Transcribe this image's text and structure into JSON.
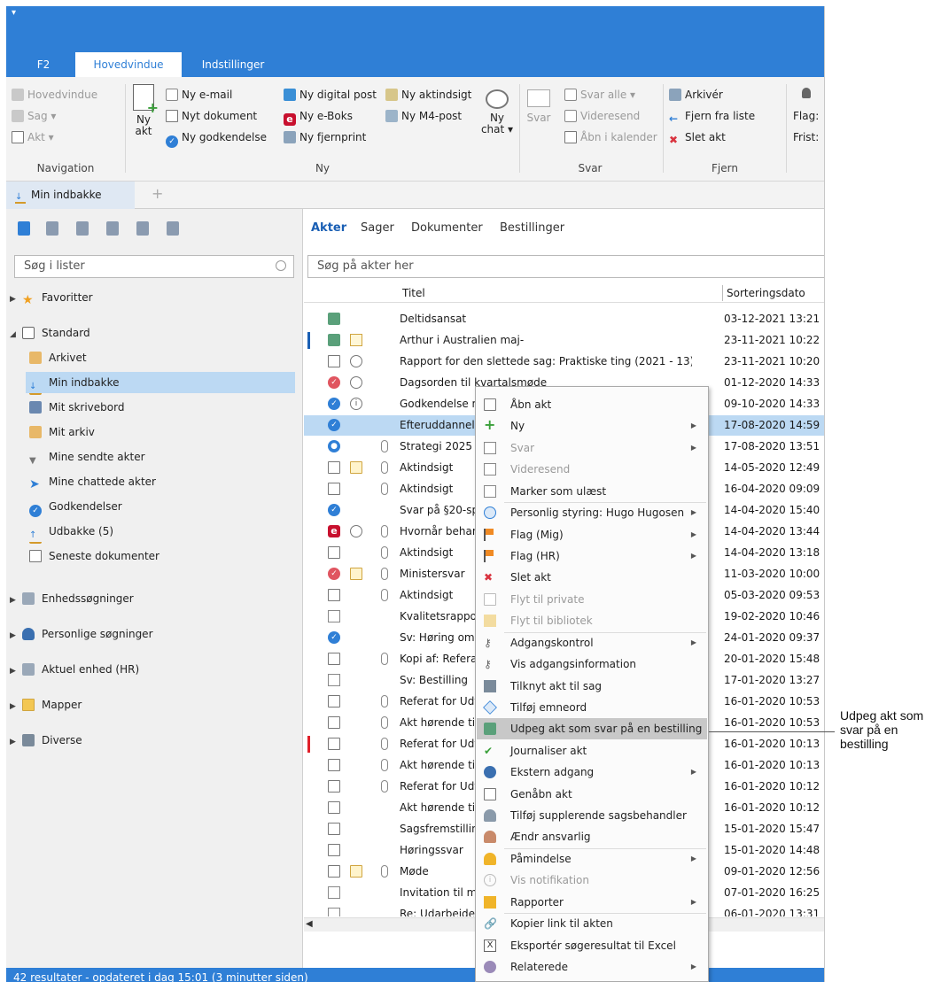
{
  "ribbon": {
    "tabs": [
      {
        "label": "F2",
        "active": false
      },
      {
        "label": "Hovedvindue",
        "active": true
      },
      {
        "label": "Indstillinger",
        "active": false
      }
    ],
    "navigation": {
      "label": "Navigation",
      "items": [
        "Hovedvindue",
        "Sag ▾",
        "Akt ▾"
      ]
    },
    "ny": {
      "label": "Ny",
      "big_button": "Ny akt",
      "col1": [
        "Ny e-mail",
        "Nyt dokument",
        "Ny godkendelse"
      ],
      "col2": [
        "Ny digital post",
        "Ny e-Boks",
        "Ny fjernprint"
      ],
      "col3": [
        "Ny aktindsigt",
        "Ny M4-post"
      ],
      "chat_button": "Ny chat ▾"
    },
    "svar": {
      "label": "Svar",
      "big_button": "Svar",
      "items": [
        "Svar alle ▾",
        "Videresend",
        "Åbn i kalender"
      ]
    },
    "fjern": {
      "label": "Fjern",
      "items": [
        "Arkivér",
        "Fjern fra liste",
        "Slet akt"
      ]
    },
    "flag_label": "Flag:",
    "frist_label": "Frist:"
  },
  "doc_tab": {
    "label": "Min indbakke"
  },
  "left": {
    "search_placeholder": "Søg i lister",
    "favoritter": "Favoritter",
    "standard": "Standard",
    "standard_items": [
      "Arkivet",
      "Min indbakke",
      "Mit skrivebord",
      "Mit arkiv",
      "Mine sendte akter",
      "Mine chattede akter",
      "Godkendelser",
      "Udbakke (5)",
      "Seneste dokumenter"
    ],
    "groups": [
      "Enhedssøgninger",
      "Personlige søgninger",
      "Aktuel enhed (HR)",
      "Mapper",
      "Diverse"
    ]
  },
  "right": {
    "tabs": [
      "Akter",
      "Sager",
      "Dokumenter",
      "Bestillinger"
    ],
    "search_placeholder": "Søg på akter her",
    "col_title": "Titel",
    "col_date": "Sorteringsdato",
    "rows": [
      {
        "title": "Deltidsansat",
        "date": "03-12-2021 13:21"
      },
      {
        "title": "Arthur i Australien maj-juli",
        "date": "23-11-2021 10:22"
      },
      {
        "title": "Rapport for den slettede sag: Praktiske ting (2021 - 13)",
        "date": "23-11-2021 10:20"
      },
      {
        "title": "Dagsorden til kvartalsmøde",
        "date": "01-12-2020 14:33"
      },
      {
        "title": "Godkendelse m",
        "date": "09-10-2020 14:33"
      },
      {
        "title": "Efteruddannelse",
        "date": "17-08-2020 14:59"
      },
      {
        "title": "Strategi 2025",
        "date": "17-08-2020 13:51"
      },
      {
        "title": "Aktindsigt",
        "date": "14-05-2020 12:49"
      },
      {
        "title": "Aktindsigt",
        "date": "16-04-2020 09:09"
      },
      {
        "title": "Svar på §20-sprø",
        "date": "14-04-2020 15:40"
      },
      {
        "title": "Hvornår behand",
        "date": "14-04-2020 13:44"
      },
      {
        "title": "Aktindsigt",
        "date": "14-04-2020 13:18"
      },
      {
        "title": "Ministersvar",
        "date": "11-03-2020 10:00"
      },
      {
        "title": "Aktindsigt",
        "date": "05-03-2020 09:53"
      },
      {
        "title": "Kvalitetsrapport",
        "date": "19-02-2020 10:46"
      },
      {
        "title": "Sv: Høring om h",
        "date": "24-01-2020 09:37"
      },
      {
        "title": "Kopi af: Referat f",
        "date": "20-01-2020 15:48"
      },
      {
        "title": "Sv: Bestilling",
        "date": "17-01-2020 13:27"
      },
      {
        "title": "Referat for Udva",
        "date": "16-01-2020 10:53"
      },
      {
        "title": "Akt hørende til c",
        "date": "16-01-2020 10:53"
      },
      {
        "title": "Referat for Udva",
        "date": "16-01-2020 10:13"
      },
      {
        "title": "Akt hørende til c",
        "date": "16-01-2020 10:13"
      },
      {
        "title": "Referat for Udva",
        "date": "16-01-2020 10:12"
      },
      {
        "title": "Akt hørende til c",
        "date": "16-01-2020 10:12"
      },
      {
        "title": "Sagsfremstilling",
        "date": "15-01-2020 15:47"
      },
      {
        "title": "Høringssvar",
        "date": "15-01-2020 14:48"
      },
      {
        "title": "Møde",
        "date": "09-01-2020 12:56"
      },
      {
        "title": "Invitation til mø",
        "date": "07-01-2020 16:25"
      },
      {
        "title": "Re: Udarbejdelse",
        "date": "06-01-2020 13:31"
      }
    ]
  },
  "context_menu": [
    "Åbn akt",
    "Ny",
    "Svar",
    "Videresend",
    "Marker som ulæst",
    "Personlig styring: Hugo Hugosen",
    "Flag (Mig)",
    "Flag (HR)",
    "Slet akt",
    "Flyt til private",
    "Flyt til bibliotek",
    "Adgangskontrol",
    "Vis adgangsinformation",
    "Tilknyt akt til sag",
    "Tilføj emneord",
    "Udpeg akt som svar på en bestilling",
    "Journaliser akt",
    "Ekstern adgang",
    "Genåbn akt",
    "Tilføj supplerende sagsbehandler",
    "Ændr ansvarlig",
    "Påmindelse",
    "Vis notifikation",
    "Rapporter",
    "Kopier link til akten",
    "Eksportér søgeresultat til Excel",
    "Relaterede"
  ],
  "status": "42 resultater - opdateret i dag 15:01 (3 minutter siden)",
  "callout": "Udpeg akt som svar på en bestilling",
  "colors": {
    "accent": "#2f7fd6",
    "selection": "#bcd9f3",
    "highlight": "#c8c8c8"
  }
}
